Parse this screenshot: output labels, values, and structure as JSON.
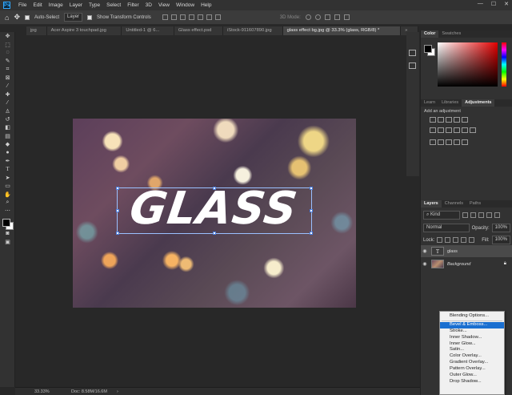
{
  "menubar": {
    "logo": "Ps",
    "items": [
      "File",
      "Edit",
      "Image",
      "Layer",
      "Type",
      "Select",
      "Filter",
      "3D",
      "View",
      "Window",
      "Help"
    ]
  },
  "window_controls": {
    "minimize": "—",
    "maximize": "☐",
    "close": "✕"
  },
  "options_bar": {
    "auto_select_label": "Auto-Select",
    "auto_select_target": "Layer",
    "show_transform_label": "Show Transform Controls",
    "three_d_mode_label": "3D Mode:"
  },
  "tabs": [
    {
      "label": "jpg",
      "active": false
    },
    {
      "label": "Acer Aspire 3 touchpad.jpg",
      "active": false
    },
    {
      "label": "Untitled-1 @ 6...",
      "active": false
    },
    {
      "label": "Glass effect.psd",
      "active": false
    },
    {
      "label": "iStock-911607890.jpg",
      "active": false
    },
    {
      "label": "glass effect bg.jpg @ 33.3% (glass, RGB/8) *",
      "active": true
    }
  ],
  "canvas": {
    "text": "GLASS"
  },
  "color_panel": {
    "tabs": [
      "Color",
      "Swatches"
    ]
  },
  "adjustments_panel": {
    "tabs": [
      "Learn",
      "Libraries",
      "Adjustments"
    ],
    "heading": "Add an adjustment"
  },
  "layers_panel": {
    "tabs": [
      "Layers",
      "Channels",
      "Paths"
    ],
    "filter_kind": "Kind",
    "blend_mode": "Normal",
    "opacity_label": "Opacity:",
    "opacity_value": "100%",
    "lock_label": "Lock:",
    "fill_label": "Fill:",
    "fill_value": "100%",
    "layers": [
      {
        "name": "glass",
        "type": "text",
        "selected": true
      },
      {
        "name": "Background",
        "type": "image",
        "selected": false
      }
    ]
  },
  "context_menu": {
    "items": [
      {
        "label": "Blending Options...",
        "highlighted": false,
        "separator_after": true
      },
      {
        "label": "Bevel & Emboss...",
        "highlighted": true
      },
      {
        "label": "Stroke...",
        "highlighted": false
      },
      {
        "label": "Inner Shadow...",
        "highlighted": false
      },
      {
        "label": "Inner Glow...",
        "highlighted": false
      },
      {
        "label": "Satin...",
        "highlighted": false
      },
      {
        "label": "Color Overlay...",
        "highlighted": false
      },
      {
        "label": "Gradient Overlay...",
        "highlighted": false
      },
      {
        "label": "Pattern Overlay...",
        "highlighted": false
      },
      {
        "label": "Outer Glow...",
        "highlighted": false
      },
      {
        "label": "Drop Shadow...",
        "highlighted": false
      }
    ]
  },
  "status_bar": {
    "zoom": "33.33%",
    "doc_info": "Doc: 8.58M/16.6M"
  },
  "colors": {
    "accent": "#1a6fd0",
    "foreground_swatch": "#000000",
    "background_swatch": "#ffffff"
  }
}
